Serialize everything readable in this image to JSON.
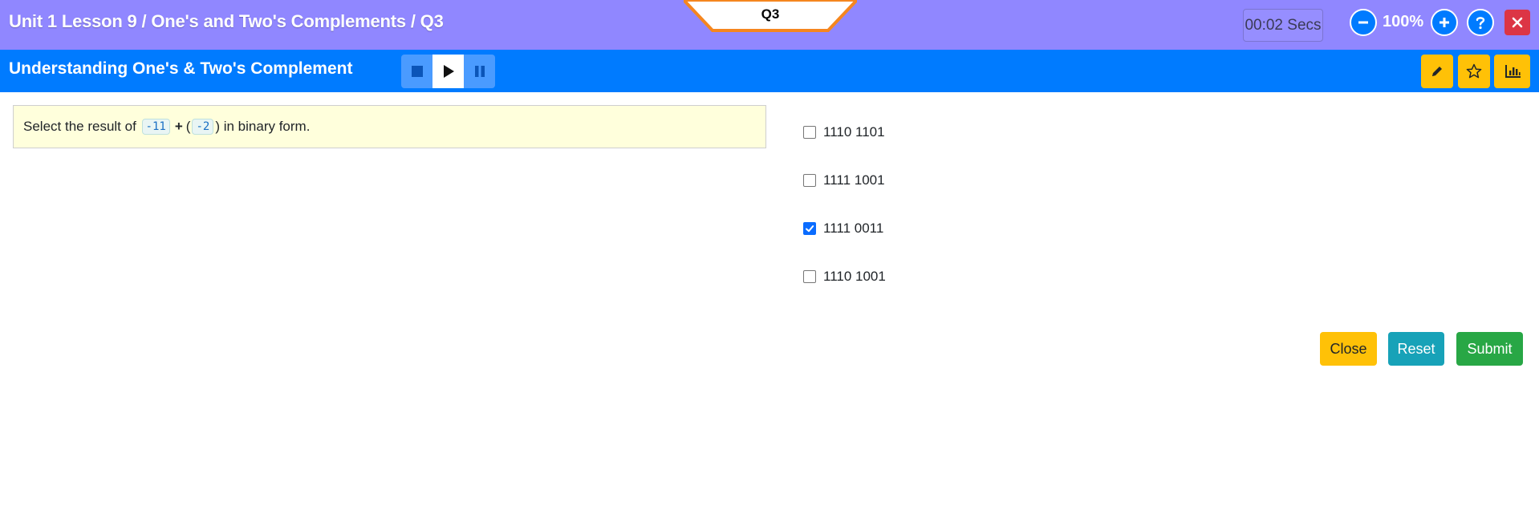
{
  "header": {
    "breadcrumb": "Unit 1 Lesson 9 / One's and Two's Complements / Q3",
    "question_tab": "Q3",
    "timer": "00:02 Secs",
    "zoom": "100%"
  },
  "subheader": {
    "title": "Understanding One's & Two's Complement"
  },
  "question": {
    "prefix": "Select the result of",
    "operand1": "-11",
    "operator": "+",
    "open_paren": "(",
    "operand2": "-2",
    "close_paren": ")",
    "suffix": "in binary form."
  },
  "options": [
    {
      "label": "1110 1101",
      "checked": false
    },
    {
      "label": "1111 1001",
      "checked": false
    },
    {
      "label": "1111 0011",
      "checked": true
    },
    {
      "label": "1110 1001",
      "checked": false
    }
  ],
  "actions": {
    "close": "Close",
    "reset": "Reset",
    "submit": "Submit"
  },
  "colors": {
    "topbar": "#9087ff",
    "subbar": "#007bff",
    "tab_border": "#f5861f",
    "warning": "#ffc107",
    "info": "#17a2b8",
    "success": "#28a745",
    "danger": "#dc3545"
  },
  "icons": {
    "zoom_out": "minus-circle-icon",
    "zoom_in": "plus-circle-icon",
    "help": "question-circle-icon",
    "close": "close-icon",
    "stop": "stop-icon",
    "play": "play-icon",
    "pause": "pause-icon",
    "pencil": "pencil-icon",
    "star": "star-icon",
    "chart": "bar-chart-icon"
  }
}
